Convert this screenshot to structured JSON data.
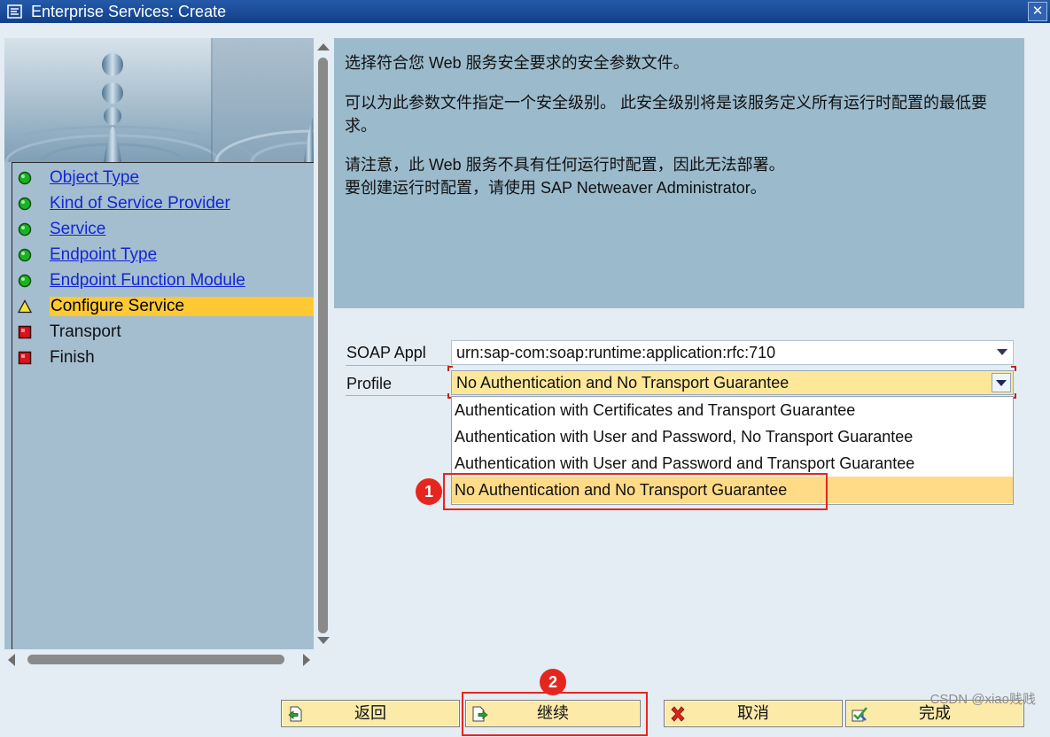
{
  "window": {
    "title": "Enterprise Services: Create",
    "close_label": "✕"
  },
  "roadmap": {
    "steps": [
      {
        "label": "Object Type",
        "status": "done",
        "link": true
      },
      {
        "label": "Kind of Service Provider",
        "status": "done",
        "link": true
      },
      {
        "label": "Service",
        "status": "done",
        "link": true
      },
      {
        "label": "Endpoint Type",
        "status": "done",
        "link": true
      },
      {
        "label": "Endpoint Function Module",
        "status": "done",
        "link": true
      },
      {
        "label": "Configure Service",
        "status": "current",
        "link": false
      },
      {
        "label": "Transport",
        "status": "pending",
        "link": false
      },
      {
        "label": "Finish",
        "status": "pending",
        "link": false
      }
    ],
    "icons": {
      "done": "green-light-icon",
      "current": "warning-triangle-icon",
      "pending": "red-stop-icon"
    }
  },
  "info": {
    "p1": "选择符合您 Web 服务安全要求的安全参数文件。",
    "p2": "可以为此参数文件指定一个安全级别。 此安全级别将是该服务定义所有运行时配置的最低要求。",
    "p3": "请注意，此 Web 服务不具有任何运行时配置，因此无法部署。",
    "p3b": "要创建运行时配置，请使用 SAP Netweaver Administrator。"
  },
  "form": {
    "soap_label": "SOAP Appl",
    "soap_value": "urn:sap-com:soap:runtime:application:rfc:710",
    "profile_label": "Profile",
    "profile_value": "No Authentication and No Transport Guarantee",
    "profile_options": [
      "Authentication with Certificates and Transport Guarantee",
      "Authentication with User and Password, No Transport Guarantee",
      "Authentication with User and Password and Transport Guarantee",
      "No Authentication and No Transport Guarantee"
    ],
    "selected_option_index": 3
  },
  "annotations": {
    "badge1": "1",
    "badge2": "2"
  },
  "buttons": {
    "back": "返回",
    "continue": "继续",
    "cancel": "取消",
    "finish": "完成"
  },
  "colors": {
    "title_bar": "#245aa9",
    "current_step": "#ffc933",
    "annotation": "#e5261f",
    "button_bg": "#fbeaa8"
  },
  "watermark": "CSDN @xiao贱贱"
}
